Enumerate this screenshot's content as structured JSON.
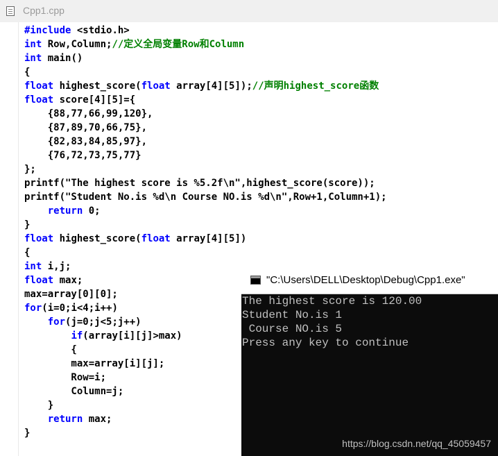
{
  "editor": {
    "tab_title": "Cpp1.cpp",
    "lines": [
      "#include <stdio.h>",
      "int Row,Column;//定义全局变量Row和Column",
      "int main()",
      "{",
      "float highest_score(float array[4][5]);//声明highest_score函数",
      "float score[4][5]={",
      "    {88,77,66,99,120},",
      "    {87,89,70,66,75},",
      "    {82,83,84,85,97},",
      "    {76,72,73,75,77}",
      "};",
      "printf(\"The highest score is %5.2f\\n\",highest_score(score));",
      "printf(\"Student No.is %d\\n Course NO.is %d\\n\",Row+1,Column+1);",
      "    return 0;",
      "}",
      "float highest_score(float array[4][5])",
      "{",
      "int i,j;",
      "float max;",
      "max=array[0][0];",
      "for(i=0;i<4;i++)",
      "    for(j=0;j<5;j++)",
      "        if(array[i][j]>max)",
      "        {",
      "        max=array[i][j];",
      "        Row=i;",
      "        Column=j;",
      "    }",
      "    return max;",
      "}"
    ]
  },
  "console": {
    "title": "\"C:\\Users\\DELL\\Desktop\\Debug\\Cpp1.exe\"",
    "output": [
      "The highest score is 120.00",
      "Student No.is 1",
      " Course NO.is 5",
      "Press any key to continue"
    ],
    "watermark": "https://blog.csdn.net/qq_45059457"
  },
  "colors": {
    "keyword": "#0000ff",
    "comment": "#008000",
    "console_bg": "#0c0c0c",
    "console_text": "#c0c0c0"
  },
  "icons": {
    "tab_icon": "document-icon",
    "console_icon": "console-window-icon"
  }
}
